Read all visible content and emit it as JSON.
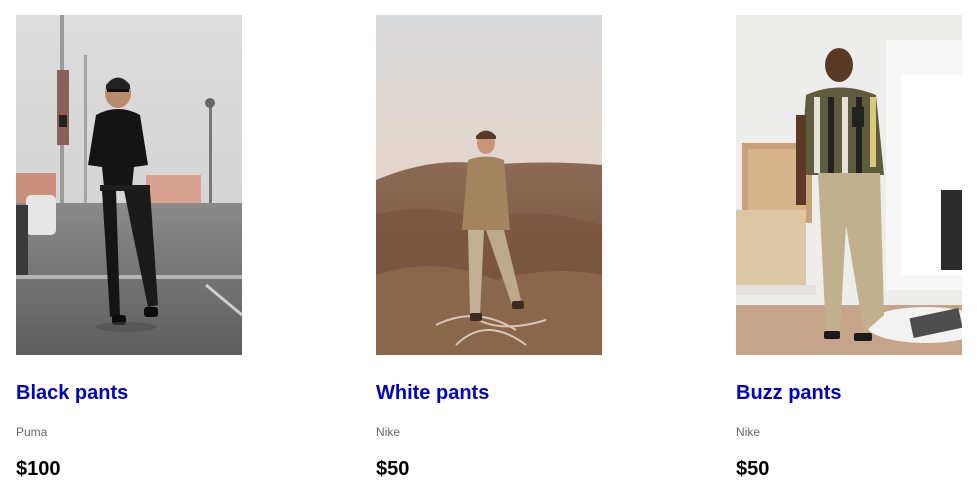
{
  "theme": {
    "title_color": "#0000cc",
    "brand_color": "#666666",
    "price_color": "#000000"
  },
  "products": [
    {
      "title": "Black pants",
      "brand": "Puma",
      "price": "$100",
      "image": "photo of man in black t-shirt and black pants with sunglasses in parking lot"
    },
    {
      "title": "White pants",
      "brand": "Nike",
      "price": "$50",
      "image": "photo of young man in tan jacket and beige pants standing in dry grass field"
    },
    {
      "title": "Buzz pants",
      "brand": "Nike",
      "price": "$50",
      "image": "photo of smiling man in striped shirt and khaki pants leaning on counter looking at phone"
    }
  ]
}
